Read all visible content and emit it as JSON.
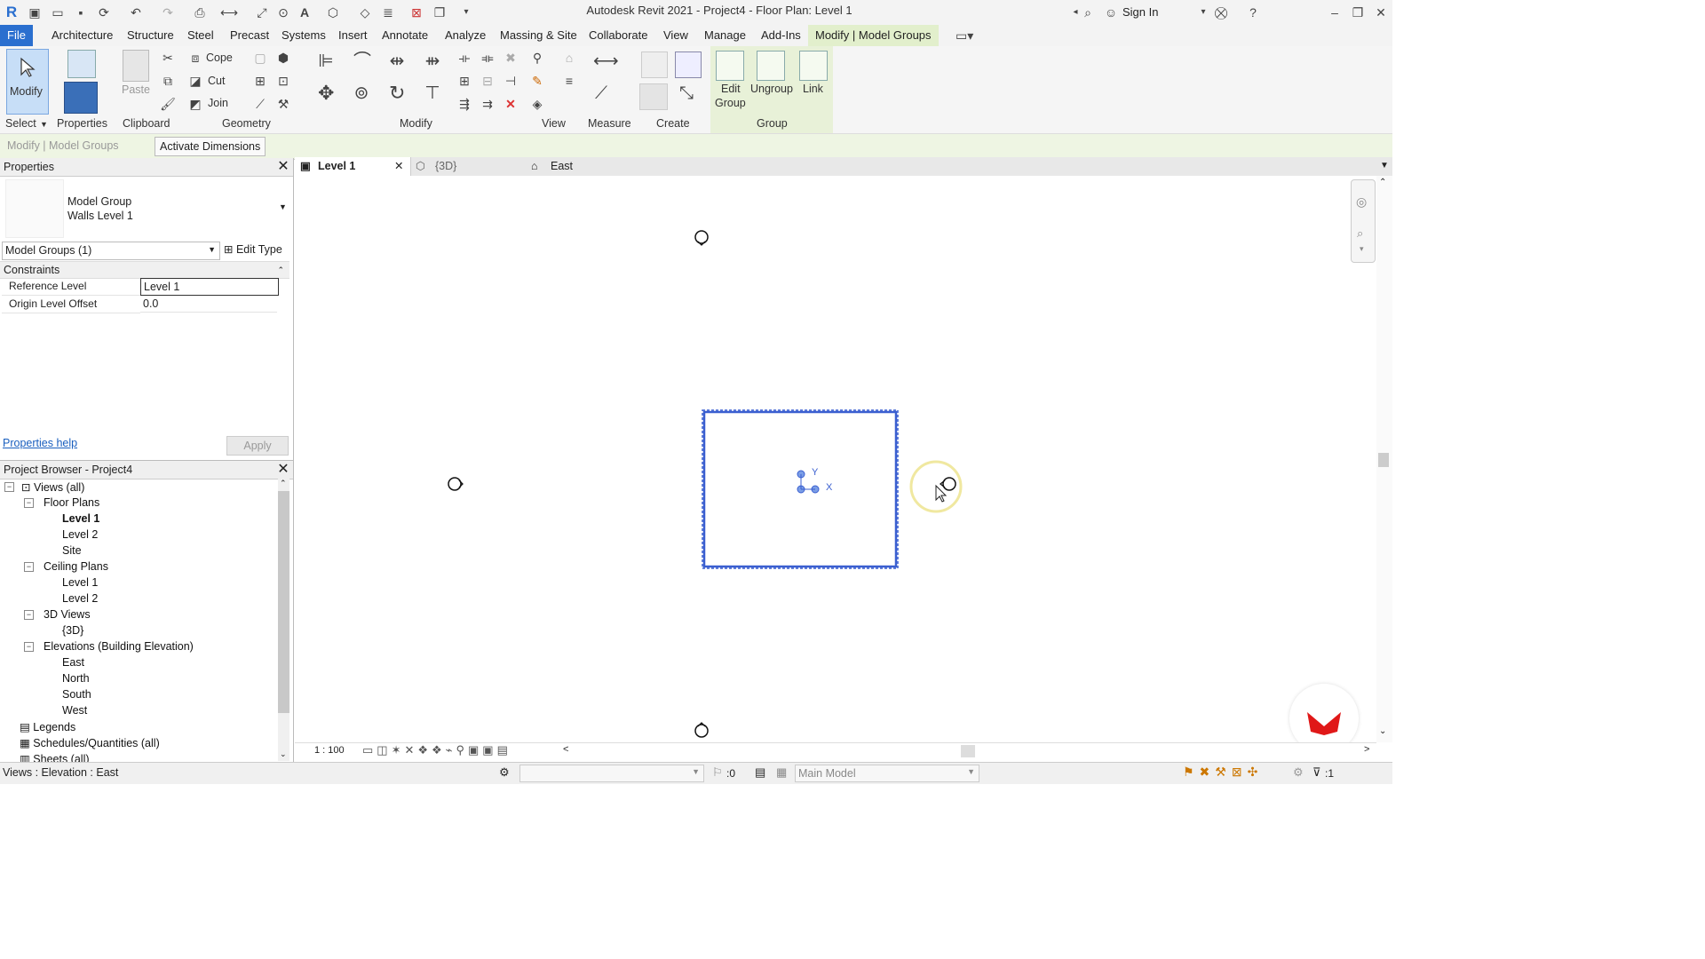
{
  "app": {
    "title": "Autodesk Revit 2021 - Project4 - Floor Plan: Level 1",
    "sign_in": "Sign In"
  },
  "menu": [
    "File",
    "Architecture",
    "Structure",
    "Steel",
    "Precast",
    "Systems",
    "Insert",
    "Annotate",
    "Analyze",
    "Massing & Site",
    "Collaborate",
    "View",
    "Manage",
    "Add-Ins",
    "Modify | Model Groups"
  ],
  "ribbon": {
    "modify": "Modify",
    "paste": "Paste",
    "cope": "Cope",
    "cut": "Cut",
    "join": "Join",
    "edit_group_1": "Edit",
    "edit_group_2": "Group",
    "ungroup": "Ungroup",
    "link": "Link",
    "groups": [
      "Select",
      "Properties",
      "Clipboard",
      "Geometry",
      "Modify",
      "View",
      "Measure",
      "Create",
      "Group"
    ]
  },
  "optbar": {
    "context": "Modify | Model Groups",
    "activate_dimensions": "Activate Dimensions"
  },
  "properties": {
    "title": "Properties",
    "type_line1": "Model Group",
    "type_line2": "Walls Level 1",
    "selector": "Model Groups (1)",
    "edit_type": "Edit Type",
    "section": "Constraints",
    "rows": [
      {
        "label": "Reference Level",
        "value": "Level 1"
      },
      {
        "label": "Origin Level Offset",
        "value": "0.0"
      }
    ],
    "help": "Properties help",
    "apply": "Apply"
  },
  "browser": {
    "title": "Project Browser - Project4",
    "items": [
      {
        "label": "Views (all)"
      },
      {
        "label": "Floor Plans"
      },
      {
        "label": "Level 1"
      },
      {
        "label": "Level 2"
      },
      {
        "label": "Site"
      },
      {
        "label": "Ceiling Plans"
      },
      {
        "label": "Level 1"
      },
      {
        "label": "Level 2"
      },
      {
        "label": "3D Views"
      },
      {
        "label": "{3D}"
      },
      {
        "label": "Elevations (Building Elevation)"
      },
      {
        "label": "East"
      },
      {
        "label": "North"
      },
      {
        "label": "South"
      },
      {
        "label": "West"
      },
      {
        "label": "Legends"
      },
      {
        "label": "Schedules/Quantities (all)"
      },
      {
        "label": "Sheets (all)"
      }
    ]
  },
  "view_tabs": [
    {
      "label": "Level 1"
    },
    {
      "label": "{3D}"
    },
    {
      "label": "East"
    }
  ],
  "canvas": {
    "y_label": "Y",
    "x_label": "X"
  },
  "viewctrl": {
    "scale": "1 : 100"
  },
  "status": {
    "text": "Views : Elevation : East",
    "count": ":0",
    "model": "Main Model",
    "filter": ":1"
  },
  "colors": {
    "accent": "#2a6fcf",
    "selection": "#3a5fd0",
    "context_tab": "#e2efcc"
  }
}
